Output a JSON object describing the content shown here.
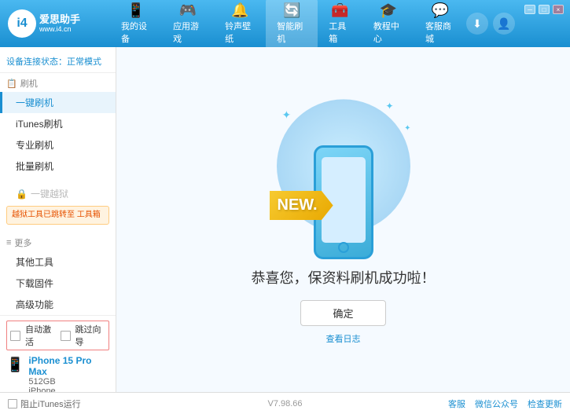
{
  "app": {
    "logo_text": "爱思助手",
    "logo_sub": "www.i4.cn",
    "logo_char": "i4"
  },
  "nav": {
    "items": [
      {
        "id": "my-device",
        "label": "我的设备",
        "icon": "📱"
      },
      {
        "id": "app-game",
        "label": "应用游戏",
        "icon": "🧩"
      },
      {
        "id": "ringtone",
        "label": "铃声壁纸",
        "icon": "🔔"
      },
      {
        "id": "smart-flash",
        "label": "智能刷机",
        "icon": "🔄"
      },
      {
        "id": "toolbox",
        "label": "工具箱",
        "icon": "🧰"
      },
      {
        "id": "tutorial",
        "label": "教程中心",
        "icon": "🎓"
      },
      {
        "id": "service",
        "label": "客服商城",
        "icon": "💬"
      }
    ]
  },
  "topbar_right": {
    "download_label": "⬇",
    "user_label": "👤"
  },
  "win_controls": [
    "─",
    "□",
    "×"
  ],
  "sidebar": {
    "status_label": "设备连接状态：",
    "status_value": "正常模式",
    "sections": [
      {
        "title": "刷机",
        "icon": "📋",
        "items": [
          {
            "id": "one-key-flash",
            "label": "一键刷机",
            "active": true
          },
          {
            "id": "itunes-flash",
            "label": "iTunes刷机",
            "active": false
          },
          {
            "id": "pro-flash",
            "label": "专业刷机",
            "active": false
          },
          {
            "id": "batch-flash",
            "label": "批量刷机",
            "active": false
          }
        ]
      }
    ],
    "disabled_section": {
      "label": "一键越狱",
      "warning": "越狱工具已跳转至\n工具箱"
    },
    "more_section": {
      "title": "更多",
      "icon": "≡",
      "items": [
        {
          "id": "other-tools",
          "label": "其他工具"
        },
        {
          "id": "download-firmware",
          "label": "下载固件"
        },
        {
          "id": "advanced",
          "label": "高级功能"
        }
      ]
    },
    "auto_row": {
      "auto_activate": "自动激活",
      "auto_guide": "跳过向导"
    },
    "device": {
      "name": "iPhone 15 Pro Max",
      "storage": "512GB",
      "type": "iPhone"
    }
  },
  "content": {
    "new_badge": "NEW.",
    "success_text": "恭喜您，保资料刷机成功啦！",
    "confirm_btn": "确定",
    "view_log": "查看日志"
  },
  "footer": {
    "no_itunes_label": "阻止iTunes运行",
    "version": "V7.98.66",
    "links": [
      "客服",
      "微信公众号",
      "检查更新"
    ]
  }
}
